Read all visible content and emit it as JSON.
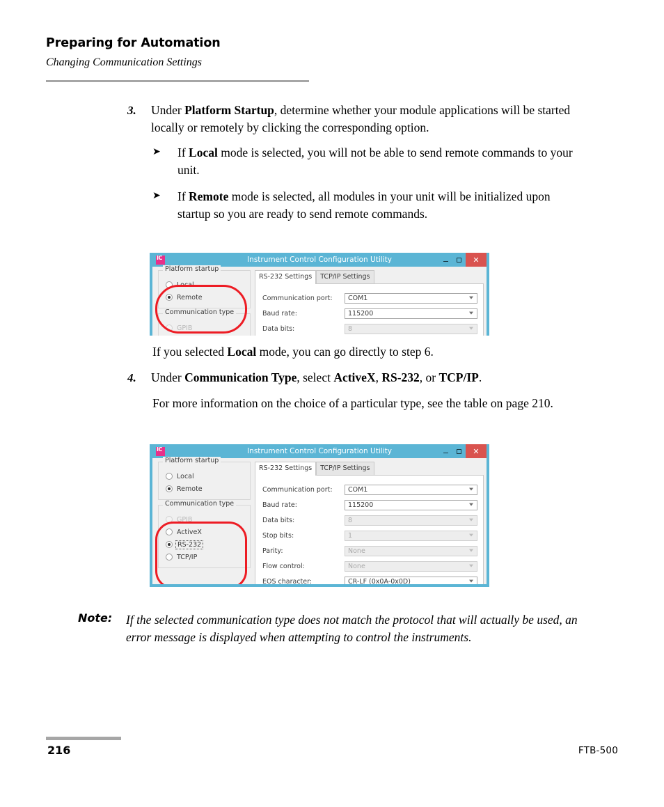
{
  "header": {
    "title": "Preparing for Automation",
    "subtitle": "Changing Communication Settings"
  },
  "steps": {
    "step3": {
      "number": "3.",
      "text_before_bold": "Under ",
      "bold": "Platform Startup",
      "text_after_bold": ", determine whether your module applications will be started locally or remotely by clicking the corresponding option.",
      "bullets": [
        {
          "glyph": "➤",
          "lead": "If ",
          "bold": "Local",
          "rest": " mode is selected, you will not be able to send remote commands to your unit."
        },
        {
          "glyph": "➤",
          "lead": "If ",
          "bold": "Remote",
          "rest": " mode is selected, all modules in your unit will be initialized upon startup so you are ready to send remote commands."
        }
      ]
    },
    "after_shot1": {
      "lead": "If you selected ",
      "bold": "Local",
      "rest": " mode, you can go directly to step 6."
    },
    "step4": {
      "number": "4.",
      "p1_lead": "Under ",
      "p1_bold1": "Communication Type",
      "p1_mid": ", select ",
      "p1_bold2": "ActiveX",
      "p1_sep1": ", ",
      "p1_bold3": "RS-232",
      "p1_sep2": ", or ",
      "p1_bold4": "TCP/IP",
      "p1_end": ".",
      "p2": "For more information on the choice of a particular type, see the table on page 210."
    }
  },
  "note": {
    "label": "Note:",
    "text": "If the selected communication type does not match the protocol that will actually be used, an error message is displayed when attempting to control the instruments."
  },
  "footer": {
    "page_number": "216",
    "model": "FTB-500"
  },
  "colors": {
    "titlebar": "#5bb5d5",
    "close_button": "#d9534f",
    "annotation_red": "#ed1c24",
    "app_icon": "#e8308a",
    "rule_gray": "#a6a6a6"
  },
  "screenshot1": {
    "window_title": "Instrument Control Configuration Utility",
    "app_icon_label": "IC",
    "buttons": {
      "minimize": "–",
      "maximize": "☐",
      "close": "✕"
    },
    "platform_startup": {
      "legend": "Platform startup",
      "options": [
        {
          "label": "Local",
          "checked": false,
          "disabled": false,
          "focused": false
        },
        {
          "label": "Remote",
          "checked": true,
          "disabled": false,
          "focused": false
        }
      ]
    },
    "communication_type": {
      "legend": "Communication type",
      "options": [
        {
          "label": "GPIB",
          "checked": false,
          "disabled": true,
          "focused": false
        }
      ]
    },
    "tabs": [
      {
        "label": "RS-232 Settings",
        "active": true
      },
      {
        "label": "TCP/IP Settings",
        "active": false
      }
    ],
    "fields": [
      {
        "label": "Communication port:",
        "value": "COM1",
        "disabled": false
      },
      {
        "label": "Baud rate:",
        "value": "115200",
        "disabled": false
      },
      {
        "label": "Data bits:",
        "value": "8",
        "disabled": true
      }
    ]
  },
  "screenshot2": {
    "window_title": "Instrument Control Configuration Utility",
    "app_icon_label": "IC",
    "buttons": {
      "minimize": "–",
      "maximize": "☐",
      "close": "✕"
    },
    "platform_startup": {
      "legend": "Platform startup",
      "options": [
        {
          "label": "Local",
          "checked": false,
          "disabled": false,
          "focused": false
        },
        {
          "label": "Remote",
          "checked": true,
          "disabled": false,
          "focused": false
        }
      ]
    },
    "communication_type": {
      "legend": "Communication type",
      "options": [
        {
          "label": "GPIB",
          "checked": false,
          "disabled": true,
          "focused": false
        },
        {
          "label": "ActiveX",
          "checked": false,
          "disabled": false,
          "focused": false
        },
        {
          "label": "RS-232",
          "checked": true,
          "disabled": false,
          "focused": true
        },
        {
          "label": "TCP/IP",
          "checked": false,
          "disabled": false,
          "focused": false
        }
      ]
    },
    "tabs": [
      {
        "label": "RS-232 Settings",
        "active": true
      },
      {
        "label": "TCP/IP Settings",
        "active": false
      }
    ],
    "fields": [
      {
        "label": "Communication port:",
        "value": "COM1",
        "disabled": false
      },
      {
        "label": "Baud rate:",
        "value": "115200",
        "disabled": false
      },
      {
        "label": "Data bits:",
        "value": "8",
        "disabled": true
      },
      {
        "label": "Stop bits:",
        "value": "1",
        "disabled": true
      },
      {
        "label": "Parity:",
        "value": "None",
        "disabled": true
      },
      {
        "label": "Flow control:",
        "value": "None",
        "disabled": true
      },
      {
        "label": "EOS character:",
        "value": "CR-LF (0x0A-0x0D)",
        "disabled": false
      }
    ]
  }
}
